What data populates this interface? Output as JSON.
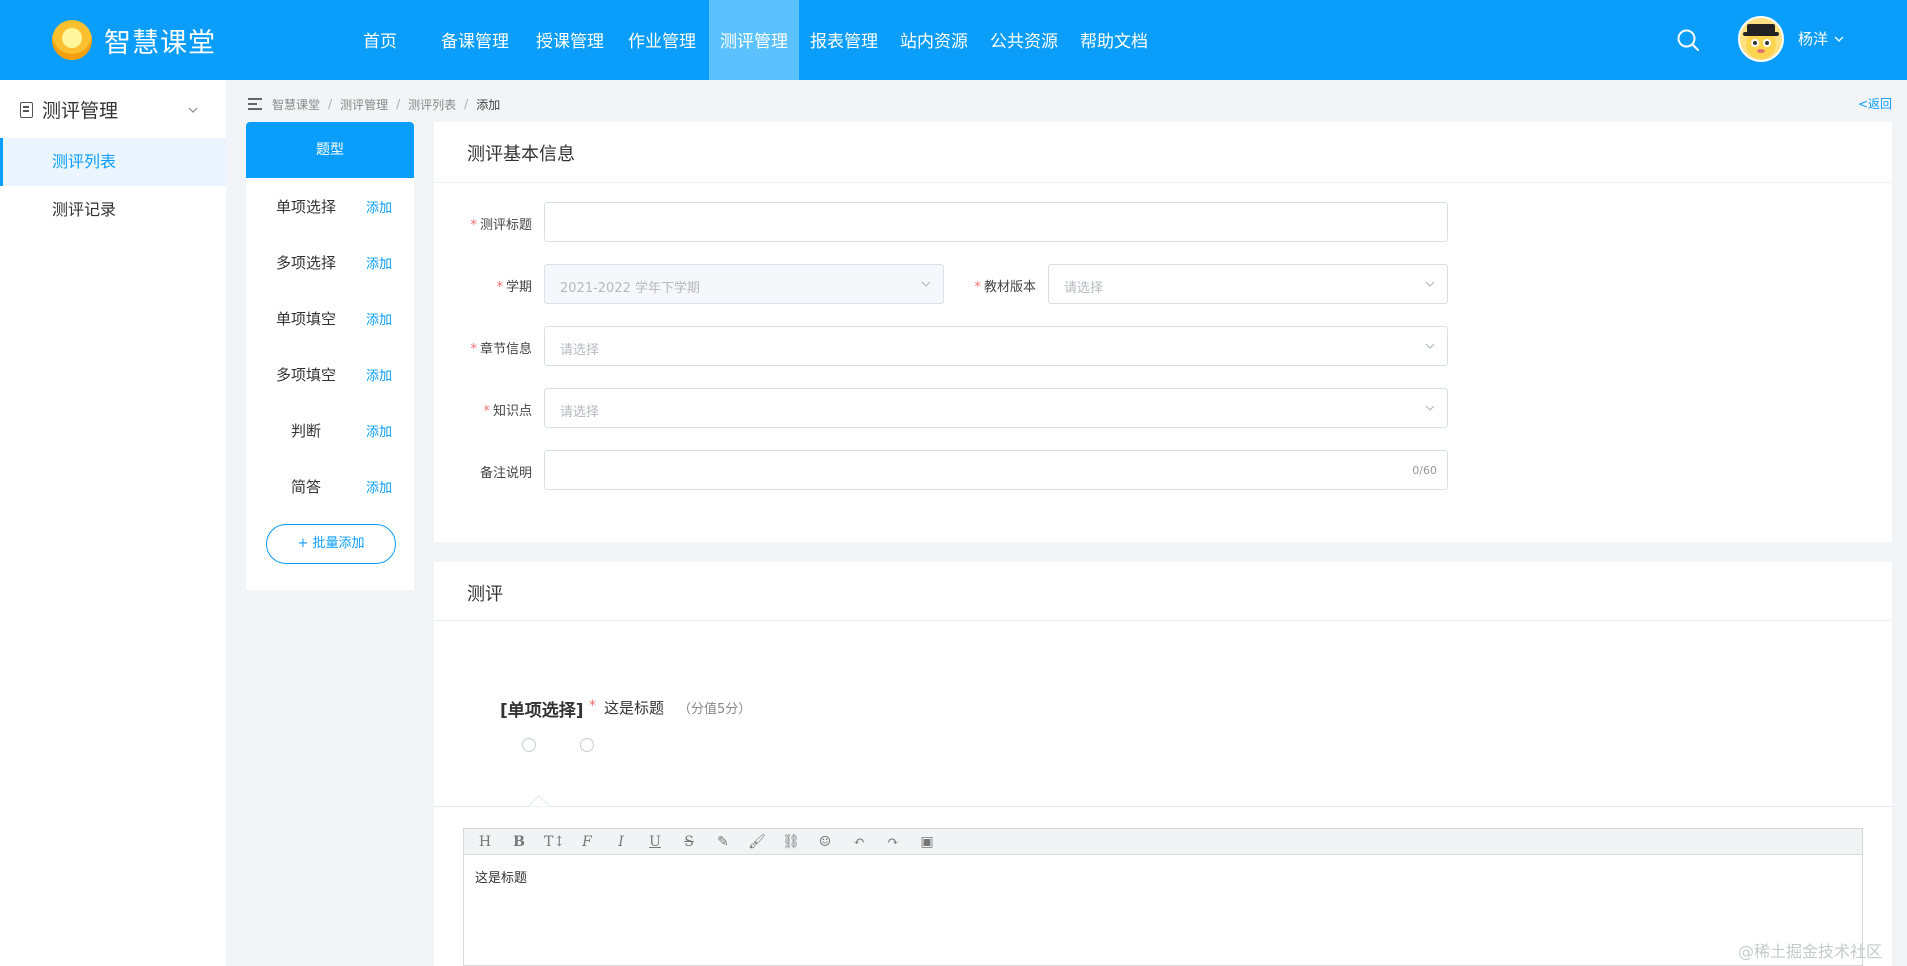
{
  "header": {
    "app_title": "智慧课堂",
    "nav": [
      {
        "label": "首页",
        "active": false
      },
      {
        "label": "备课管理",
        "active": false
      },
      {
        "label": "授课管理",
        "active": false
      },
      {
        "label": "作业管理",
        "active": false
      },
      {
        "label": "测评管理",
        "active": true
      },
      {
        "label": "报表管理",
        "active": false
      },
      {
        "label": "站内资源",
        "active": false
      },
      {
        "label": "公共资源",
        "active": false
      },
      {
        "label": "帮助文档",
        "active": false
      }
    ],
    "username": "杨洋",
    "accent_color": "#0a9dfa"
  },
  "sidebar": {
    "group_label": "测评管理",
    "items": [
      {
        "label": "测评列表",
        "active": true
      },
      {
        "label": "测评记录",
        "active": false
      }
    ]
  },
  "breadcrumb": {
    "items": [
      "智慧课堂",
      "测评管理",
      "测评列表",
      "添加"
    ],
    "back_label": "<返回"
  },
  "question_types": {
    "header": "题型",
    "add_label": "添加",
    "items": [
      "单项选择",
      "多项选择",
      "单项填空",
      "多项填空",
      "判断",
      "简答"
    ],
    "batch_add_label": "批量添加"
  },
  "basic_info": {
    "title": "测评基本信息",
    "fields": {
      "eval_title": {
        "label": "测评标题",
        "required": true,
        "value": ""
      },
      "semester": {
        "label": "学期",
        "required": true,
        "value": "2021-2022 学年下学期",
        "disabled": true
      },
      "textbook": {
        "label": "教材版本",
        "required": true,
        "placeholder": "请选择"
      },
      "chapter": {
        "label": "章节信息",
        "required": true,
        "placeholder": "请选择"
      },
      "knowledge": {
        "label": "知识点",
        "required": true,
        "placeholder": "请选择"
      },
      "remark": {
        "label": "备注说明",
        "required": false,
        "value": "",
        "counter": "0/60"
      }
    }
  },
  "evaluation": {
    "title": "测评",
    "question": {
      "type_label": "[单项选择]",
      "required_mark": "*",
      "title": "这是标题",
      "score": "（分值5分）"
    },
    "editor": {
      "toolbar": [
        "heading-icon",
        "bold-icon",
        "text-size-icon",
        "font-icon",
        "italic-icon",
        "underline-icon",
        "strikethrough-icon",
        "highlight-icon",
        "brush-icon",
        "link-icon",
        "emoji-icon",
        "undo-icon",
        "redo-icon",
        "image-icon"
      ],
      "content": "这是标题"
    }
  },
  "watermark": "@稀土掘金技术社区"
}
